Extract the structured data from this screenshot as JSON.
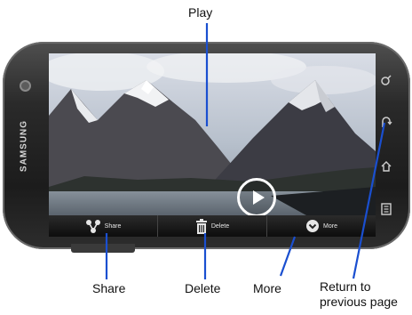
{
  "callouts": {
    "play": "Play",
    "share": "Share",
    "delete": "Delete",
    "more": "More",
    "return": "Return to previous page"
  },
  "phone": {
    "brand": "SAMSUNG"
  },
  "action_bar": {
    "share_label": "Share",
    "delete_label": "Delete",
    "more_label": "More"
  },
  "icons": {
    "play": "play-icon",
    "share": "share-icon",
    "delete": "trash-icon",
    "more": "chevron-down-circle-icon",
    "search_key": "search-key-icon",
    "back_key": "back-key-icon",
    "home_key": "home-key-icon",
    "menu_key": "menu-key-icon"
  },
  "colors": {
    "pointer_line": "#1a4fd0",
    "phone_body": "#2a2a2a",
    "action_bar": "#111111"
  }
}
